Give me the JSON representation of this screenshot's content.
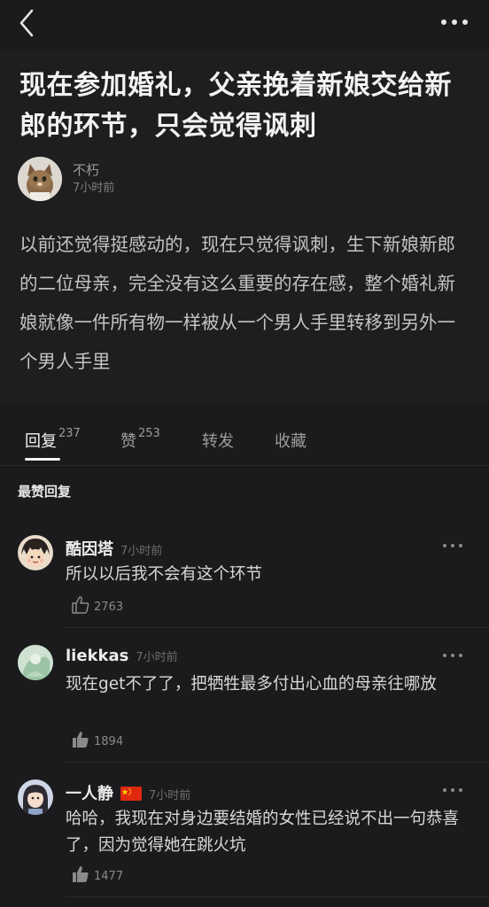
{
  "post": {
    "title": "现在参加婚礼，父亲挽着新娘交给新郎的环节，只会觉得讽刺",
    "author_name": "不朽",
    "time": "7小时前",
    "body": "以前还觉得挺感动的，现在只觉得讽刺，生下新娘新郎的二位母亲，完全没有这么重要的存在感，整个婚礼新娘就像一件所有物一样被从一个男人手里转移到另外一个男人手里"
  },
  "tabs": [
    {
      "label": "回复",
      "count": "237"
    },
    {
      "label": "赞",
      "count": "253"
    },
    {
      "label": "转发",
      "count": ""
    },
    {
      "label": "收藏",
      "count": ""
    }
  ],
  "section_title": "最赞回复",
  "comments": [
    {
      "name": "酷因塔",
      "time": "7小时前",
      "text": "所以以后我不会有这个环节",
      "likes": "2763",
      "liked_icon": "thumbs-up-outline"
    },
    {
      "name": "liekkas",
      "time": "7小时前",
      "text": "现在get不了了，把牺牲最多付出心血的母亲往哪放",
      "likes": "1894",
      "liked_icon": "thumbs-up-filled"
    },
    {
      "name": "一人静",
      "time": "7小时前",
      "text": "哈哈，我现在对身边要结婚的女性已经说不出一句恭喜了，因为觉得她在跳火坑",
      "likes": "1477",
      "liked_icon": "thumbs-up-filled",
      "flag": "china-flag"
    }
  ],
  "colors": {
    "background": "#1b1b1d",
    "text": "#e8e8e8",
    "muted": "#8a8a8a"
  }
}
